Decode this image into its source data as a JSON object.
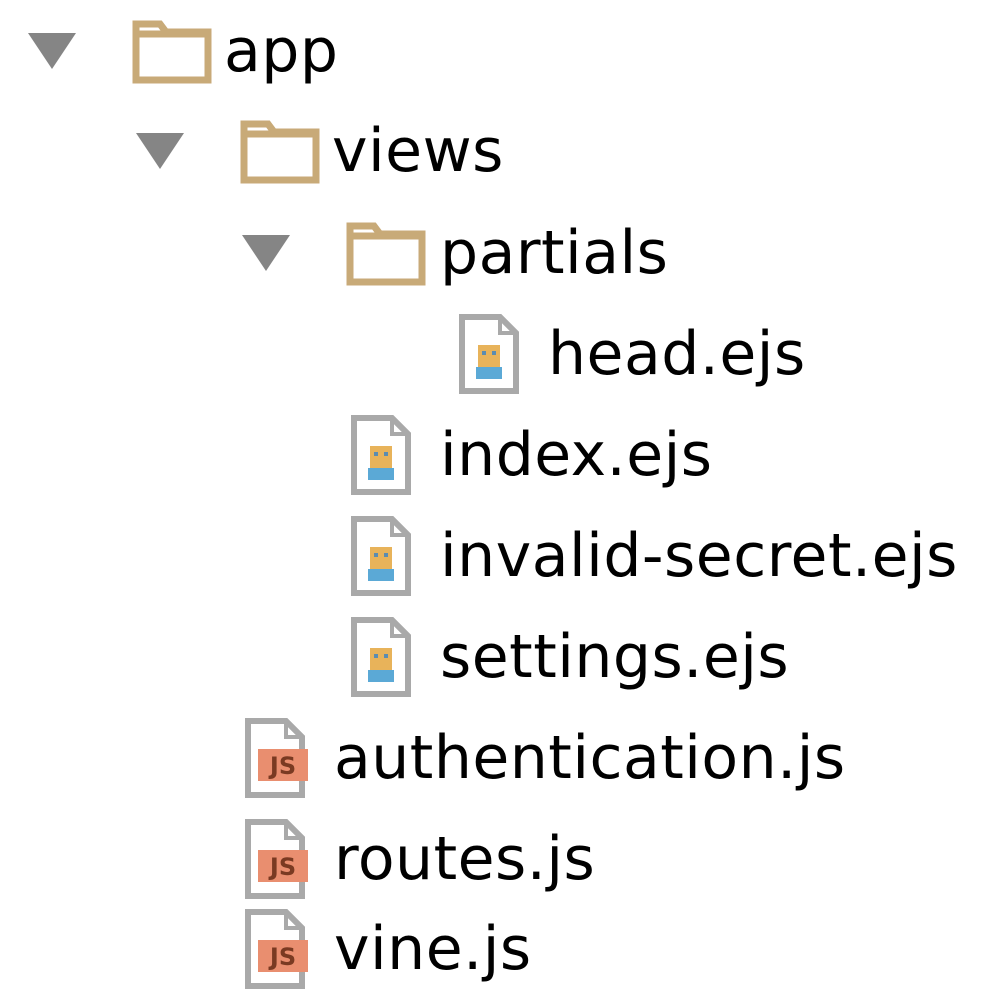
{
  "colors": {
    "folder": "#c8aa78",
    "triangle": "#858585",
    "file_border": "#a9a9a9",
    "ejs_face": "#e8b35a",
    "ejs_body": "#5ba9d6",
    "js_badge": "#e98e6f",
    "js_text": "#7a3a22"
  },
  "tree": [
    {
      "label": "app",
      "type": "folder",
      "expanded": true,
      "depth": 0
    },
    {
      "label": "views",
      "type": "folder",
      "expanded": true,
      "depth": 1
    },
    {
      "label": "partials",
      "type": "folder",
      "expanded": true,
      "depth": 2
    },
    {
      "label": "head.ejs",
      "type": "ejs-file",
      "depth": 3
    },
    {
      "label": "index.ejs",
      "type": "ejs-file",
      "depth": 2
    },
    {
      "label": "invalid-secret.ejs",
      "type": "ejs-file",
      "depth": 2
    },
    {
      "label": "settings.ejs",
      "type": "ejs-file",
      "depth": 2
    },
    {
      "label": "authentication.js",
      "type": "js-file",
      "depth": 1,
      "badge": "JS"
    },
    {
      "label": "routes.js",
      "type": "js-file",
      "depth": 1,
      "badge": "JS"
    },
    {
      "label": "vine.js",
      "type": "js-file",
      "depth": 1,
      "badge": "JS"
    }
  ]
}
